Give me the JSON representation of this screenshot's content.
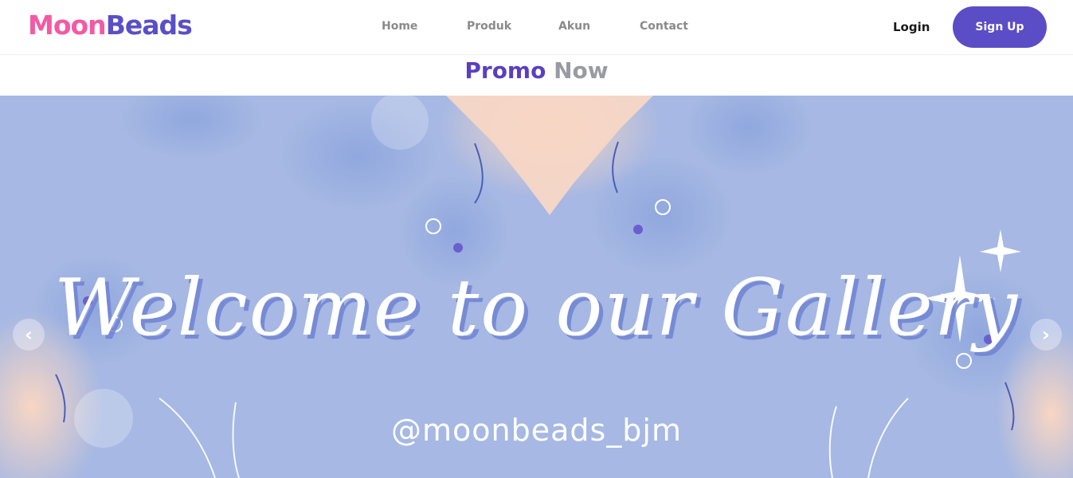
{
  "brand": {
    "part1": "Moon",
    "part2": "Beads"
  },
  "nav": {
    "items": [
      "Home",
      "Produk",
      "Akun",
      "Contact"
    ]
  },
  "auth": {
    "login": "Login",
    "signup": "Sign Up"
  },
  "promo": {
    "word1": "Promo",
    "word2": "Now"
  },
  "banner": {
    "title": "Welcome to our Gallery",
    "handle": "@moonbeads_bjm",
    "prev_icon": "chevron-left-icon",
    "next_icon": "chevron-right-icon",
    "prev_glyph": "‹",
    "next_glyph": "›"
  },
  "colors": {
    "brand_pink": "#f25aa4",
    "brand_purple": "#5a4fc8",
    "button": "#5b4dc5",
    "banner_bg": "#a6b8e3"
  }
}
